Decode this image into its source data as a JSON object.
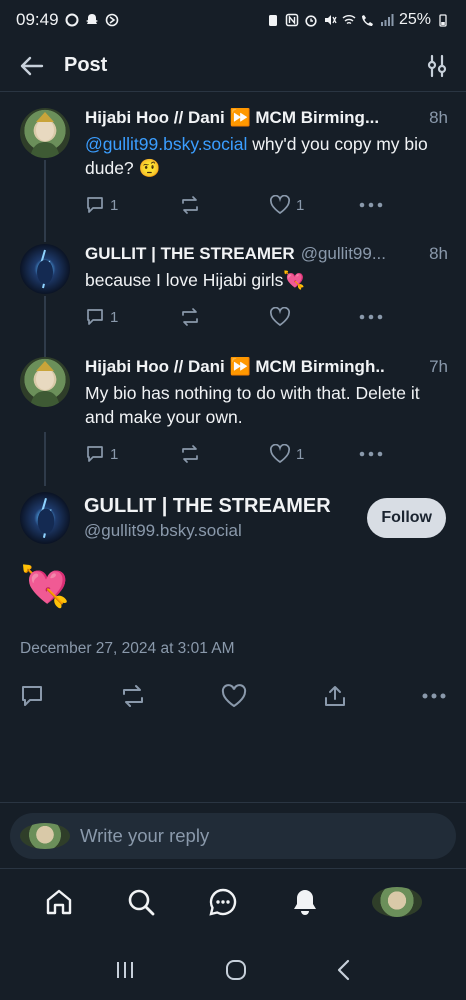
{
  "status_bar": {
    "time": "09:49",
    "battery": "25%"
  },
  "header": {
    "title": "Post"
  },
  "replies": [
    {
      "name": "Hijabi Hoo // Dani ⏩ MCM Birming...",
      "handle": "",
      "time": "8h",
      "mention": "@gullit99.bsky.social",
      "text": " why'd you copy my bio dude? 🤨",
      "reply_count": "1",
      "repost_count": "",
      "like_count": "1",
      "avatar": "hijabi"
    },
    {
      "name": "GULLIT | THE STREAMER",
      "handle": "@gullit99...",
      "time": "8h",
      "mention": "",
      "text": "because I love Hijabi girls💘",
      "reply_count": "1",
      "repost_count": "",
      "like_count": "",
      "avatar": "gullit"
    },
    {
      "name": "Hijabi Hoo // Dani ⏩ MCM Birmingh..",
      "handle": "",
      "time": "7h",
      "mention": "",
      "text": "My bio has nothing to do with that. Delete it and make your own.",
      "reply_count": "1",
      "repost_count": "",
      "like_count": "1",
      "avatar": "hijabi"
    }
  ],
  "main_post": {
    "name": "GULLIT | THE STREAMER",
    "handle": "@gullit99.bsky.social",
    "follow_label": "Follow",
    "text": "💘",
    "date": "December 27, 2024 at 3:01 AM"
  },
  "reply_bar": {
    "placeholder": "Write your reply"
  },
  "icons": {
    "back": "arrow-left-icon",
    "settings": "sliders-icon",
    "reply": "speech-bubble-icon",
    "repost": "repost-icon",
    "like": "heart-icon",
    "more": "ellipsis-icon",
    "share": "share-icon",
    "home": "home-icon",
    "search": "search-icon",
    "chat": "chat-icon",
    "notifications": "bell-icon"
  },
  "colors": {
    "background": "#161e27",
    "accent": "#3b9eff",
    "muted": "#8a99ab",
    "follow_bg": "#d8dde4"
  }
}
